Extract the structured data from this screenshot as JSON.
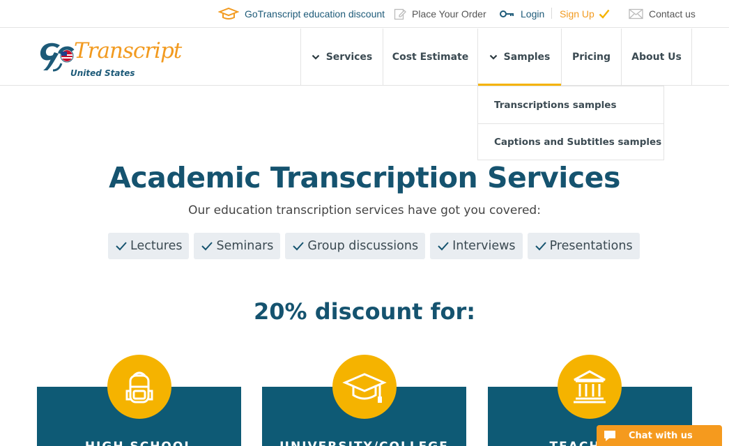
{
  "topbar": {
    "education_discount": "GoTranscript education discount",
    "place_order": "Place Your Order",
    "login": "Login",
    "signup": "Sign Up",
    "contact": "Contact us"
  },
  "logo": {
    "wordmark": "Transcript",
    "country": "United States"
  },
  "nav": {
    "services": "Services",
    "cost_estimate": "Cost Estimate",
    "samples": "Samples",
    "pricing": "Pricing",
    "about": "About Us"
  },
  "dropdown": {
    "items": [
      "Transcriptions samples",
      "Captions and Subtitles samples"
    ]
  },
  "hero": {
    "title": "Academic Transcription Services",
    "subtitle": "Our education transcription services have got you covered:",
    "tags": [
      "Lectures",
      "Seminars",
      "Group discussions",
      "Interviews",
      "Presentations"
    ]
  },
  "discount": {
    "title": "20% discount for:",
    "cards": [
      {
        "label": "HIGH SCHOOL",
        "icon": "backpack-icon"
      },
      {
        "label": "UNIVERSITY/COLLEGE",
        "icon": "graduation-cap-icon"
      },
      {
        "label": "TEACHERS",
        "icon": "institution-icon"
      }
    ]
  },
  "chat": {
    "label": "Chat with us"
  },
  "colors": {
    "primary": "#15536f",
    "accent": "#f29a1f",
    "card_bg": "#0e5a75",
    "circle": "#f5b300"
  }
}
